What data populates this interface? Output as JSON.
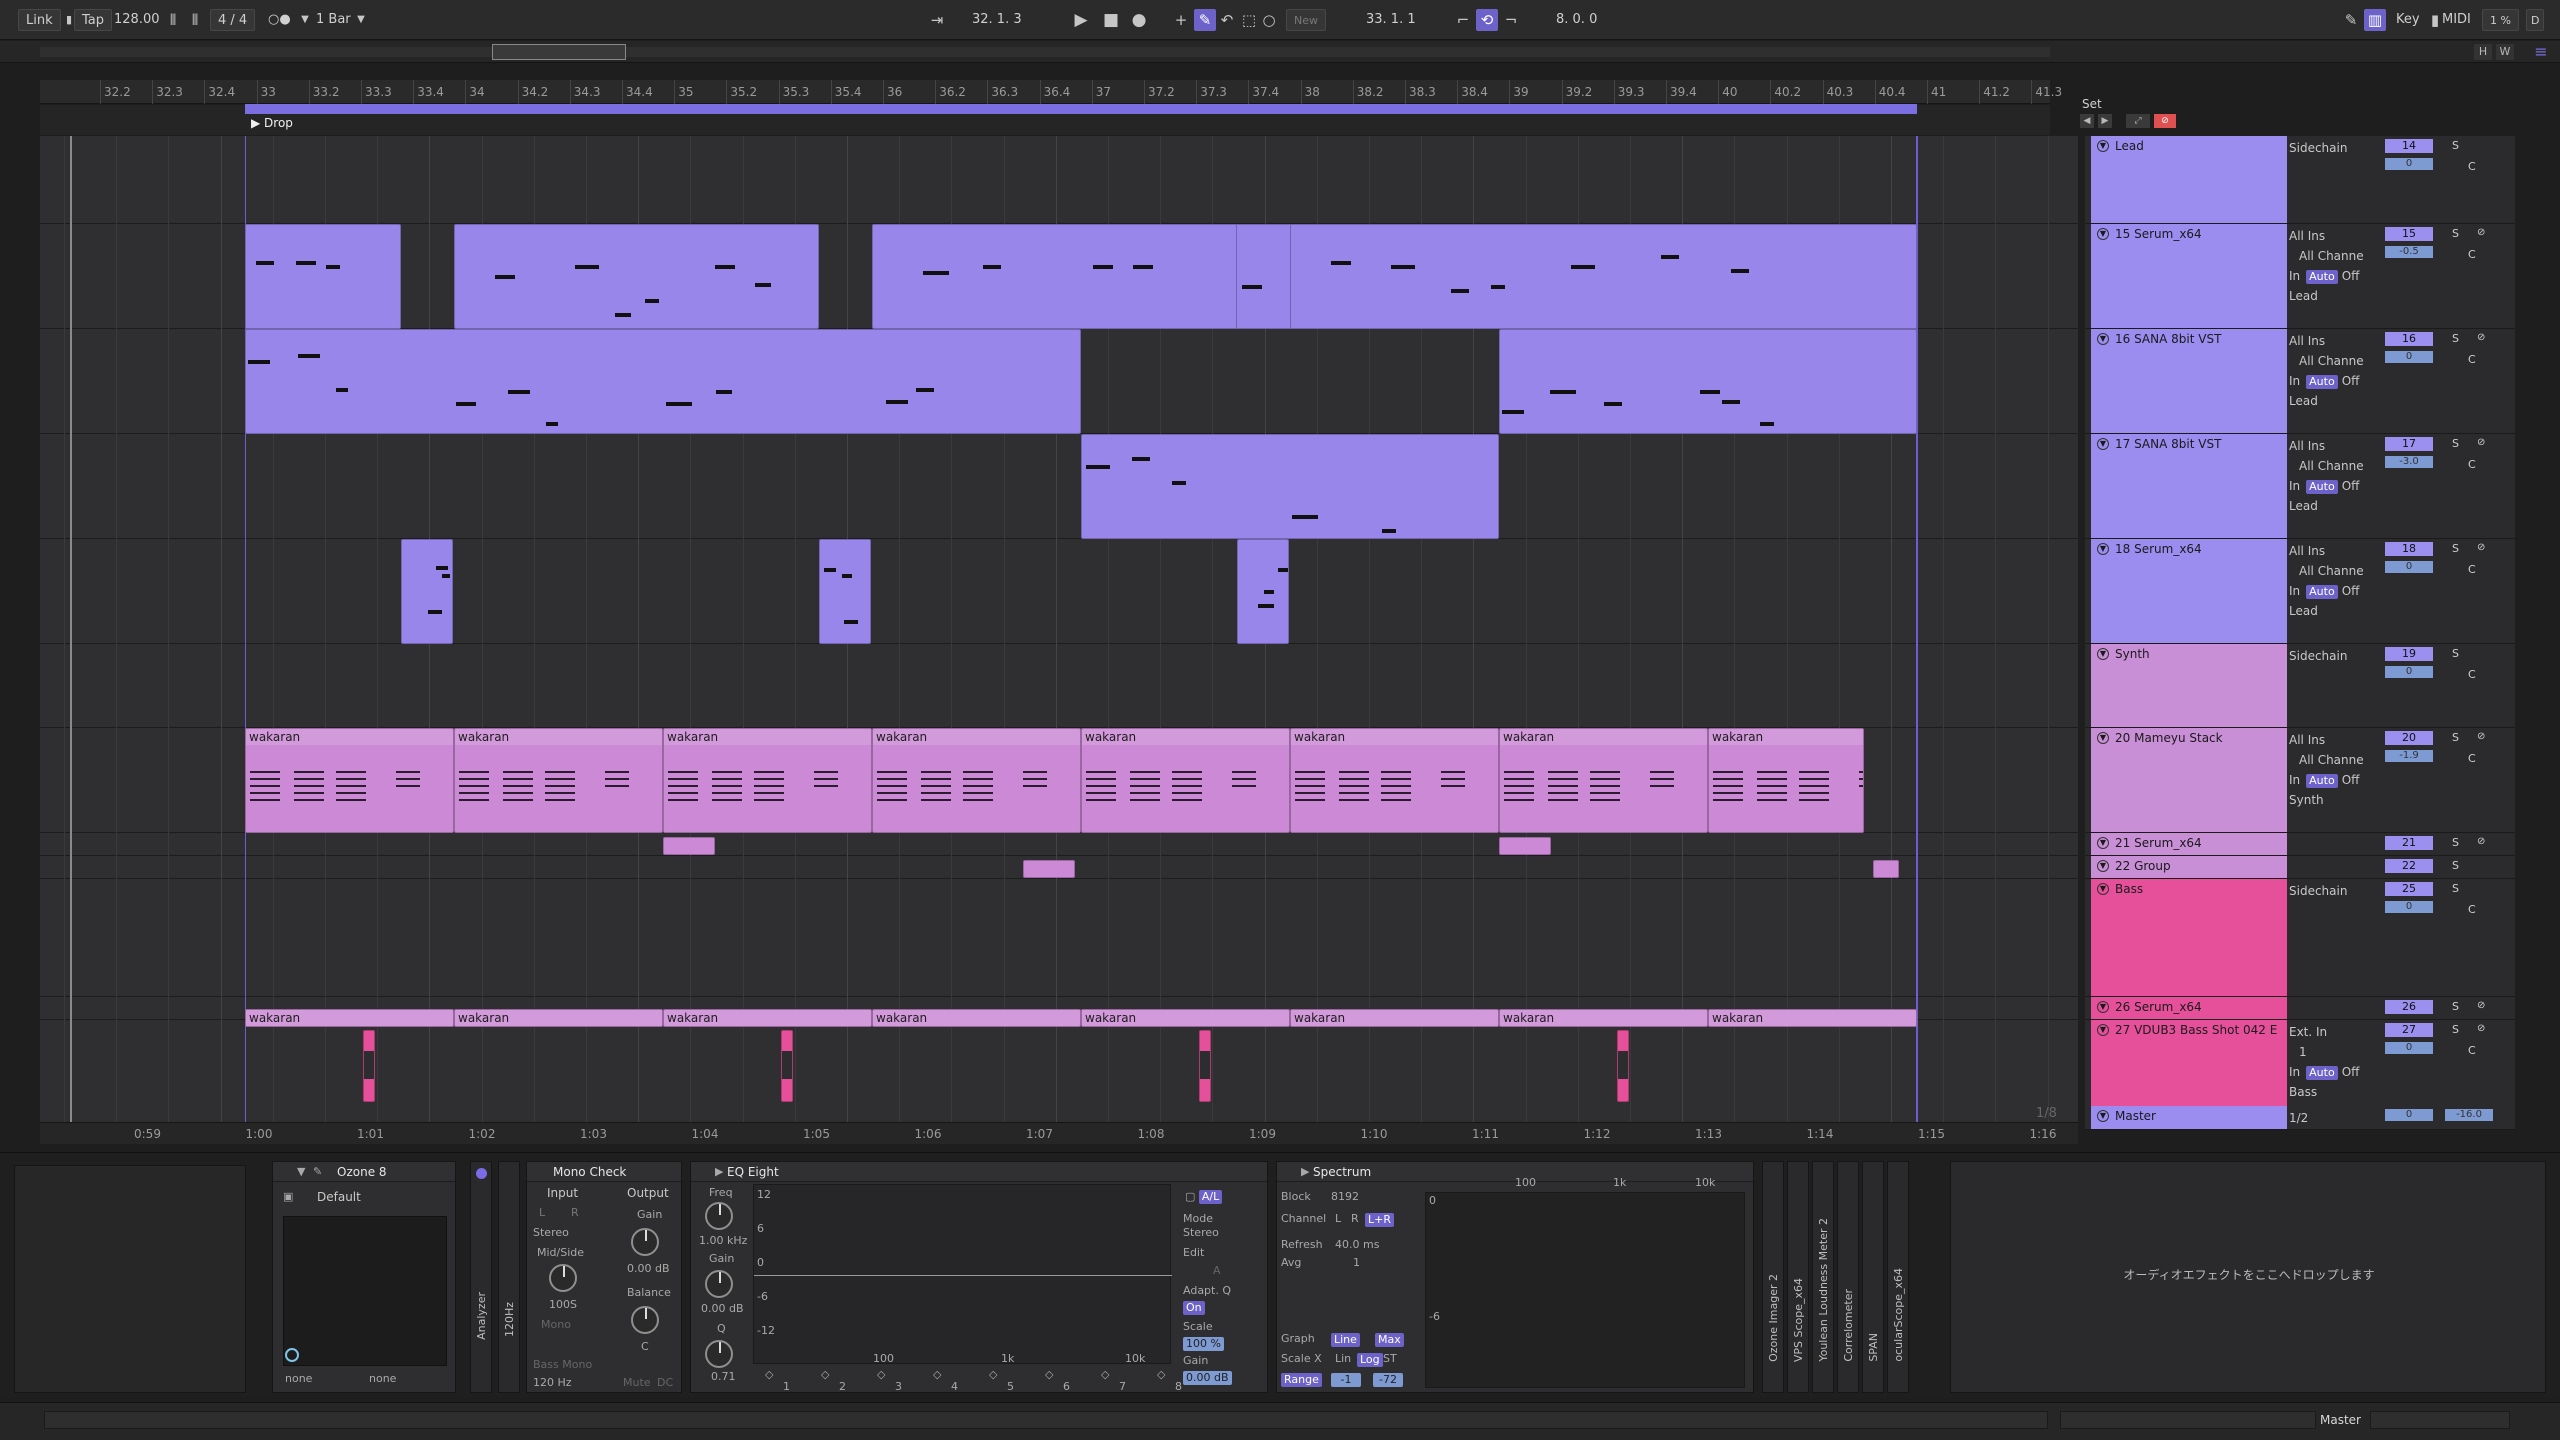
{
  "transport": {
    "link": "Link",
    "tap": "Tap",
    "tempo": "128.00",
    "signature": "4 / 4",
    "quantize": "1 Bar",
    "position": "32.  1.  3",
    "new_label": "New",
    "loop_start": "33.  1.  1",
    "loop_length": "8.  0.  0",
    "key": "Key",
    "midi": "MIDI",
    "cpu": "1 %",
    "d_label": "D",
    "s_label": "S",
    "h_label": "H",
    "w_label": "W"
  },
  "ruler": [
    "32.2",
    "32.3",
    "32.4",
    "33",
    "33.2",
    "33.3",
    "33.4",
    "34",
    "34.2",
    "34.3",
    "34.4",
    "35",
    "35.2",
    "35.3",
    "35.4",
    "36",
    "36.2",
    "36.3",
    "36.4",
    "37",
    "37.2",
    "37.3",
    "37.4",
    "38",
    "38.2",
    "38.3",
    "38.4",
    "39",
    "39.2",
    "39.3",
    "39.4",
    "40",
    "40.2",
    "40.3",
    "40.4",
    "41",
    "41.2",
    "41.3"
  ],
  "scene_marker": "Drop",
  "set_label": "Set",
  "timeline": [
    "0:59",
    "1:00",
    "1:01",
    "1:02",
    "1:03",
    "1:04",
    "1:05",
    "1:06",
    "1:07",
    "1:08",
    "1:09",
    "1:10",
    "1:11",
    "1:12",
    "1:13",
    "1:14",
    "1:15",
    "1:16"
  ],
  "page_indicator": "1/8",
  "clip_label": "wakaran",
  "tracks": [
    {
      "name": "Lead",
      "input": "Sidechain",
      "number": "14",
      "vol": "0",
      "color": "#9b8cf0"
    },
    {
      "name": "15 Serum_x64",
      "input": "All Ins",
      "channel": "All Channe",
      "monitor_in": "In",
      "monitor_auto": "Auto",
      "monitor_off": "Off",
      "output": "Lead",
      "number": "15",
      "vol": "-0.5",
      "color": "#9b8cf0"
    },
    {
      "name": "16 SANA 8bit VST",
      "input": "All Ins",
      "channel": "All Channe",
      "monitor_in": "In",
      "monitor_auto": "Auto",
      "monitor_off": "Off",
      "output": "Lead",
      "number": "16",
      "vol": "0",
      "color": "#9b8cf0"
    },
    {
      "name": "17 SANA 8bit VST",
      "input": "All Ins",
      "channel": "All Channe",
      "monitor_in": "In",
      "monitor_auto": "Auto",
      "monitor_off": "Off",
      "output": "Lead",
      "number": "17",
      "vol": "-3.0",
      "color": "#9b8cf0"
    },
    {
      "name": "18 Serum_x64",
      "input": "All Ins",
      "channel": "All Channe",
      "monitor_in": "In",
      "monitor_auto": "Auto",
      "monitor_off": "Off",
      "output": "Lead",
      "number": "18",
      "vol": "0",
      "color": "#9b8cf0"
    },
    {
      "name": "Synth",
      "input": "Sidechain",
      "number": "19",
      "vol": "0",
      "color": "#c98fd6"
    },
    {
      "name": "20 Mameyu Stack",
      "input": "All Ins",
      "channel": "All Channe",
      "monitor_in": "In",
      "monitor_auto": "Auto",
      "monitor_off": "Off",
      "output": "Synth",
      "number": "20",
      "vol": "-1.9",
      "color": "#c98fd6"
    },
    {
      "name": "21 Serum_x64",
      "number": "21",
      "color": "#c98fd6"
    },
    {
      "name": "22 Group",
      "number": "22",
      "color": "#c98fd6"
    },
    {
      "name": "Bass",
      "input": "Sidechain",
      "number": "25",
      "vol": "0",
      "color": "#e6509a"
    },
    {
      "name": "26 Serum_x64",
      "number": "26",
      "color": "#e6509a"
    },
    {
      "name": "27 VDUB3 Bass Shot 042 E",
      "input": "Ext. In",
      "channel": "1",
      "monitor_in": "In",
      "monitor_auto": "Auto",
      "monitor_off": "Off",
      "output": "Bass",
      "number": "27",
      "vol": "0",
      "color": "#e6509a"
    },
    {
      "name": "Master",
      "input": "1/2",
      "vol": "0",
      "peak": "-16.0",
      "color": "#9b8cf0"
    }
  ],
  "devices": {
    "ozone": {
      "title": "Ozone 8",
      "preset": "Default",
      "sel1": "none",
      "sel2": "none"
    },
    "analyzer_tab": "Analyzer",
    "hz_tab": "120Hz",
    "monocheck": {
      "title": "Mono Check",
      "input_label": "Input",
      "output_label": "Output",
      "l_label": "L",
      "r_label": "R",
      "stereo": "Stereo",
      "gain_label": "Gain",
      "gain_val": "0.00 dB",
      "ms_label": "Mid/Side",
      "ms_val": "100S",
      "mono_label": "Mono",
      "balance_label": "Balance",
      "balance_val": "C",
      "bass_mono": "Bass Mono",
      "hz_val": "120 Hz",
      "mute_label": "Mute",
      "dc_label": "DC"
    },
    "eq": {
      "title": "EQ Eight",
      "freq_label": "Freq",
      "freq_val": "1.00 kHz",
      "gain_label": "Gain",
      "gain_val": "0.00 dB",
      "q_label": "Q",
      "q_val": "0.71",
      "db_scale": [
        "12",
        "6",
        "0",
        "-6",
        "-12"
      ],
      "freq_scale": [
        "100",
        "1k",
        "10k"
      ],
      "bands": [
        "1",
        "2",
        "3",
        "4",
        "5",
        "6",
        "7",
        "8"
      ],
      "mode_label": "Mode",
      "mode_val": "Stereo",
      "edit_label": "Edit",
      "edit_val": "A",
      "adapt_label": "Adapt. Q",
      "adapt_val": "On",
      "scale_label": "Scale",
      "scale_val": "100 %",
      "out_gain_label": "Gain",
      "out_gain_val": "0.00 dB",
      "a_label": "A/L"
    },
    "spectrum": {
      "title": "Spectrum",
      "block_label": "Block",
      "block_val": "8192",
      "channel_label": "Channel",
      "ch_l": "L",
      "ch_r": "R",
      "ch_lr": "L+R",
      "refresh_label": "Refresh",
      "refresh_val": "40.0 ms",
      "avg_label": "Avg",
      "avg_val": "1",
      "graph_label": "Graph",
      "graph_line": "Line",
      "graph_max": "Max",
      "scalex_label": "Scale X",
      "scalex_lin": "Lin",
      "scalex_log": "Log",
      "scalex_st": "ST",
      "range_label": "Range",
      "range_lo": "-1",
      "range_hi": "-72",
      "freq_scale": [
        "100",
        "1k",
        "10k"
      ],
      "db_scale": [
        "0",
        "-6"
      ]
    },
    "plugin_tabs": [
      "Ozone Imager 2",
      "VPS Scope_x64",
      "Youlean Loudness Meter 2",
      "Correlometer",
      "SPAN",
      "ocularScope_x64"
    ],
    "drop_hint": "オーディオエフェクトをここへドロップします"
  },
  "status": {
    "master": "Master"
  },
  "colors": {
    "accent": "#6d62c9",
    "lead": "#9886ea",
    "synth": "#cc8ad6",
    "bass": "#e6509a"
  }
}
